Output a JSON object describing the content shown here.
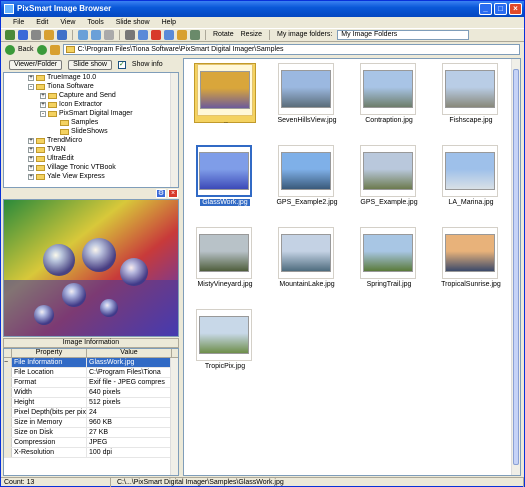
{
  "window": {
    "title": "PixSmart Image Browser"
  },
  "menu": [
    "File",
    "Edit",
    "View",
    "Tools",
    "Slide show",
    "Help"
  ],
  "toolbar": {
    "rotate_label": "Rotate",
    "resize_label": "Resize",
    "folders_label": "My image folders:",
    "folders_value": "My Image Folders"
  },
  "address": {
    "back_label": "Back",
    "path": "C:\\Program Files\\Tiona Software\\PixSmart Digital Imager\\Samples"
  },
  "panel": {
    "view_btn": "Viewer/Folder",
    "slide_btn": "Slide show",
    "show_info_label": "Show info"
  },
  "tree": [
    {
      "label": "TrueImage 10.0",
      "indent": 0
    },
    {
      "label": "Tiona Software",
      "indent": 0
    },
    {
      "label": "Capture and Send",
      "indent": 1
    },
    {
      "label": "Icon Extractor",
      "indent": 1
    },
    {
      "label": "PixSmart Digital Imager",
      "indent": 1
    },
    {
      "label": "Samples",
      "indent": 2
    },
    {
      "label": "SlideShows",
      "indent": 2
    },
    {
      "label": "TrendMicro",
      "indent": 0
    },
    {
      "label": "TVBN",
      "indent": 0
    },
    {
      "label": "UltraEdit",
      "indent": 0
    },
    {
      "label": "Village Tronic VTBook",
      "indent": 0
    },
    {
      "label": "Yale View Express",
      "indent": 0
    }
  ],
  "info": {
    "title": "Image Information",
    "col_property": "Property",
    "col_value": "Value",
    "rows": [
      {
        "k": "File Information",
        "v": "GlassWork.jpg"
      },
      {
        "k": "File Location",
        "v": "C:\\Program Files\\Tiona"
      },
      {
        "k": "Format",
        "v": "Exif file - JPEG compres"
      },
      {
        "k": "Width",
        "v": "640 pixels"
      },
      {
        "k": "Height",
        "v": "512 pixels"
      },
      {
        "k": "Pixel Depth(bits per pix",
        "v": "24"
      },
      {
        "k": "Size in Memory",
        "v": "960 KB"
      },
      {
        "k": "Size on Disk",
        "v": "27 KB"
      },
      {
        "k": "Compression",
        "v": "JPEG"
      },
      {
        "k": "X-Resolution",
        "v": "100 dpi"
      }
    ]
  },
  "thumbs": [
    {
      "label": "..",
      "colors": [
        "#d9a63b",
        "#6d5a9a"
      ]
    },
    {
      "label": "SevenHillsView.jpg",
      "colors": [
        "#9bb8e0",
        "#5b6d7a"
      ]
    },
    {
      "label": "Contraption.jpg",
      "colors": [
        "#a8c4e6",
        "#6d7d6a"
      ]
    },
    {
      "label": "Fishscape.jpg",
      "colors": [
        "#b9cde6",
        "#88887a"
      ]
    },
    {
      "label": "GlassWork.jpg",
      "colors": [
        "#7f9de8",
        "#3c4ab8"
      ]
    },
    {
      "label": "GPS_Example2.jpg",
      "colors": [
        "#7fb0e8",
        "#3a5a7a"
      ]
    },
    {
      "label": "GPS_Example.jpg",
      "colors": [
        "#b9c8dc",
        "#6c7a4e"
      ]
    },
    {
      "label": "LA_Marina.jpg",
      "colors": [
        "#9ec0ea",
        "#d9e0e6"
      ]
    },
    {
      "label": "MistyVineyard.jpg",
      "colors": [
        "#b8c2c8",
        "#4f5e3c"
      ]
    },
    {
      "label": "MountainLake.jpg",
      "colors": [
        "#c4d2e4",
        "#4e6c7e"
      ]
    },
    {
      "label": "SpringTrail.jpg",
      "colors": [
        "#a8c6e4",
        "#5a7a3a"
      ]
    },
    {
      "label": "TropicalSunrise.jpg",
      "colors": [
        "#e8b27a",
        "#3c4a6a"
      ]
    },
    {
      "label": "TropicPix.jpg",
      "colors": [
        "#c8d8e8",
        "#6e8e4a"
      ]
    }
  ],
  "status": {
    "count": "Count: 13",
    "path": "C:\\...\\PixSmart Digital Imager\\Samples\\GlassWork.jpg"
  }
}
